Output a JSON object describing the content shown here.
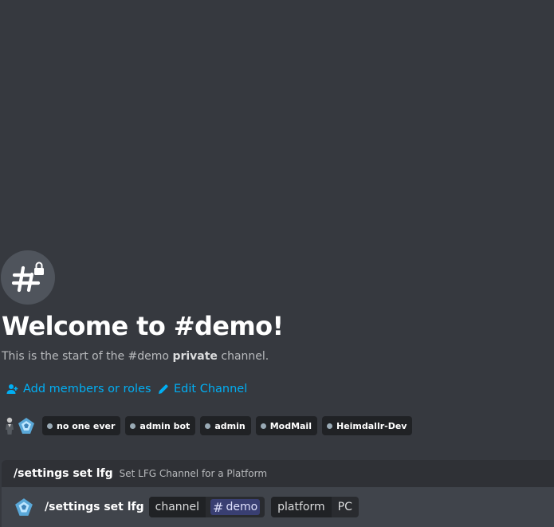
{
  "welcome": {
    "title": "Welcome to #demo!",
    "subtitle_prefix": "This is the start of the #demo ",
    "subtitle_bold": "private",
    "subtitle_suffix": " channel."
  },
  "actions": {
    "add_members_label": "Add members or roles",
    "edit_channel_label": "Edit Channel"
  },
  "roles": [
    {
      "label": "no one ever",
      "color": "#99aab5"
    },
    {
      "label": "admin bot",
      "color": "#99aab5"
    },
    {
      "label": "admin",
      "color": "#99aab5"
    },
    {
      "label": "ModMail",
      "color": "#99aab5"
    },
    {
      "label": "Heimdallr-Dev",
      "color": "#99aab5"
    }
  ],
  "command_header": {
    "name": "/settings set lfg",
    "description": "Set LFG Channel for a Platform"
  },
  "command_input": {
    "name": "/settings set lfg",
    "options": [
      {
        "name": "channel",
        "value": "demo",
        "value_type": "channel-mention"
      },
      {
        "name": "platform",
        "value": "PC",
        "value_type": "text"
      }
    ]
  },
  "colors": {
    "background": "#36393f",
    "link": "#00aff4",
    "pill_bg": "#202225",
    "mention_bg": "#5865f2"
  }
}
